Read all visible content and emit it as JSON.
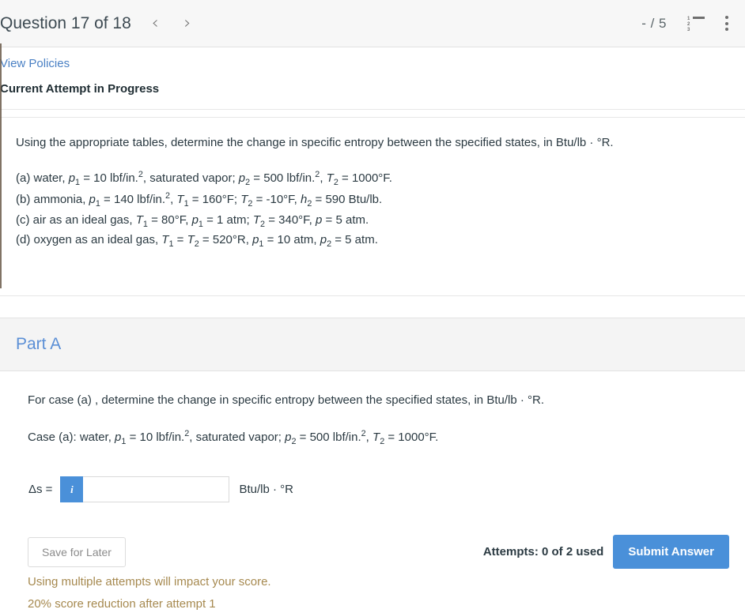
{
  "header": {
    "question_title": "Question 17 of 18",
    "prev_label": "‹",
    "next_label": "›",
    "score": "- / 5",
    "list_icon_numbers": [
      "1",
      "2",
      "3"
    ]
  },
  "policies": {
    "view_policies_label": "View Policies",
    "attempt_status": "Current Attempt in Progress"
  },
  "question": {
    "prompt_prefix": "Using the appropriate tables, determine the change in specific entropy between the specified states, in Btu/lb · °R.",
    "cases": [
      "(a) water, p1 = 10 lbf/in.2, saturated vapor; p2 = 500 lbf/in.2, T2 = 1000°F.",
      "(b) ammonia, p1 = 140 lbf/in.2, T1 = 160°F; T2 = -10°F, h2 = 590 Btu/lb.",
      "(c) air as an ideal gas, T1 = 80°F, p1 = 1 atm; T2 = 340°F, p = 5 atm.",
      "(d) oxygen as an ideal gas, T1 = T2 = 520°R, p1 = 10 atm, p2 = 5 atm."
    ],
    "case_a": {
      "label": "(a) water, ",
      "p1": "p",
      "p1sub": "1",
      "p1val": " = 10 lbf/in.",
      "p1sup": "2",
      "mid": ", saturated vapor; ",
      "p2": "p",
      "p2sub": "2",
      "p2val": " = 500 lbf/in.",
      "p2sup": "2",
      "t2": ", T",
      "t2sub": "2",
      "t2val": " = 1000°F."
    },
    "case_b": {
      "label": "(b) ammonia, ",
      "p1val": " = 140 lbf/in.",
      "p1sup": "2",
      "t1val": " = 160°F; ",
      "t2val": " = -10°F, ",
      "h2val": " = 590 Btu/lb."
    },
    "case_c": {
      "label": "(c) air as an ideal gas, ",
      "t1val": " = 80°F, ",
      "p1val": " = 1 atm; ",
      "t2val": " = 340°F, ",
      "pval": " = 5 atm."
    },
    "case_d": {
      "label": "(d) oxygen as an ideal gas, ",
      "t1t2val": " = 520°R, ",
      "p1val": " = 10 atm, ",
      "p2val": " = 5 atm."
    }
  },
  "part_a": {
    "title": "Part A",
    "instruction": "For case (a) , determine the change in specific entropy between the specified states, in Btu/lb · °R.",
    "case_restate": "Case (a): water, p1 = 10 lbf/in.2, saturated vapor; p2 = 500 lbf/in.2, T2 = 1000°F.",
    "case_restate_parts": {
      "prefix": "Case (a): water, ",
      "p1val": " = 10 lbf/in.",
      "mid": ", saturated vapor; ",
      "p2val": " = 500 lbf/in.",
      "t2val": " = 1000°F."
    },
    "answer": {
      "delta_label": "Δs =",
      "info_badge": "i",
      "input_value": "",
      "input_placeholder": "",
      "units": "Btu/lb · °R"
    }
  },
  "footer": {
    "save_label": "Save for Later",
    "attempts_text": "Attempts: 0 of 2 used",
    "submit_label": "Submit Answer",
    "warning_line_1": "Using multiple attempts will impact your score.",
    "warning_line_2": "20% score reduction after attempt 1"
  },
  "colors": {
    "accent_blue": "#4a90d9",
    "link_blue": "#4a80c4",
    "part_title_blue": "#5b8fd6",
    "warn_olive": "#a6894f",
    "header_bg": "#f7f7f7"
  }
}
